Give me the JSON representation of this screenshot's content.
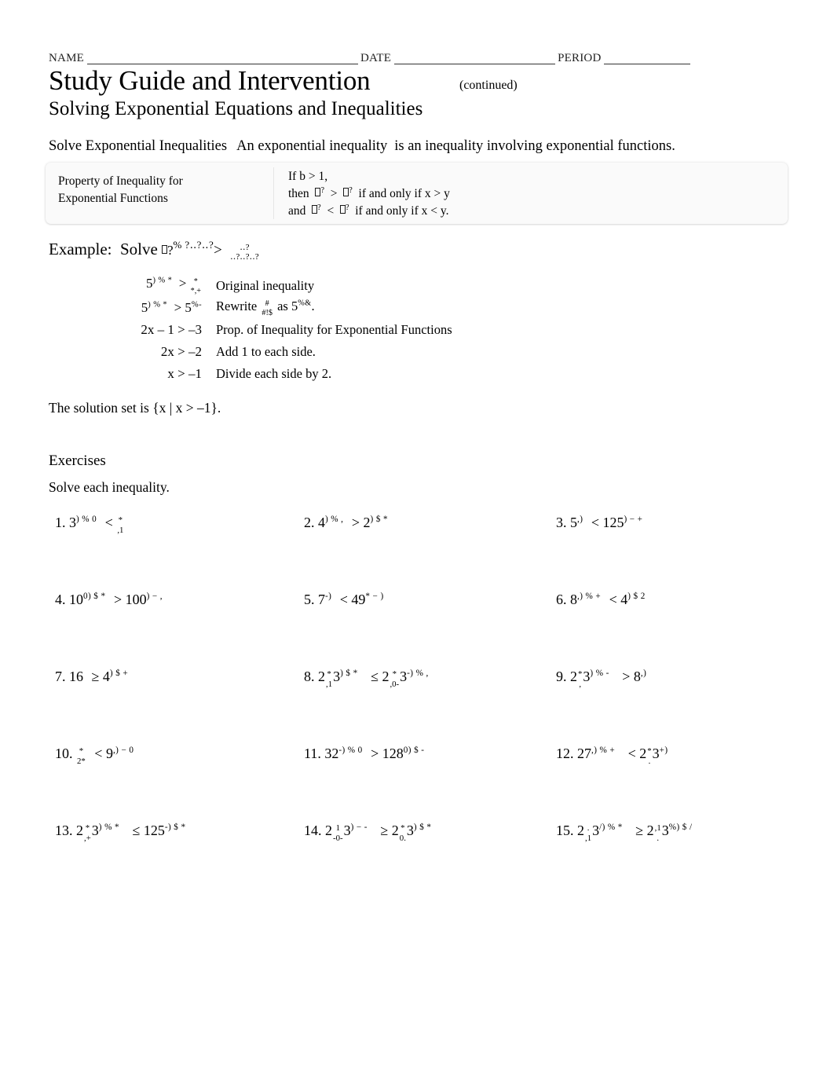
{
  "header": {
    "name_label": "NAME",
    "date_label": "DATE",
    "period_label": "PERIOD"
  },
  "title": {
    "main": "Study Guide and Intervention",
    "continued": "(continued)",
    "subtitle": "Solving Exponential Equations and Inequalities"
  },
  "lead": {
    "heading": "Solve Exponential Inequalities",
    "term": "An exponential inequality",
    "definition": "is an inequality involving exponential functions."
  },
  "property_box": {
    "label_line1": "Property of Inequality for",
    "label_line2": "Exponential Functions",
    "rule_line1": "If b > 1,",
    "rule_line2_prefix": "then",
    "rule_line2_relation": ">",
    "rule_line2_suffix": "if and only if  x > y",
    "rule_line3_prefix": "and",
    "rule_line3_relation": "<",
    "rule_line3_suffix": "if and only if  x < y."
  },
  "example": {
    "label": "Example:",
    "verb": "Solve",
    "base_glyphs": "‥?",
    "exp_glyphs": "% ?‥?‥?",
    "relation": ">",
    "frac_num": "‥?",
    "frac_den": "‥?‥?‥?"
  },
  "steps": [
    {
      "math_lead": "5",
      "math_sup": ") % *",
      "relation": ">",
      "frac_num": "*",
      "frac_den": "*,+",
      "math_tail": "",
      "desc": "Original inequality",
      "kind": "frac"
    },
    {
      "math_lead": "5",
      "math_sup": ") % *",
      "relation": ">",
      "math_tail": "5",
      "tail_sup": "%-",
      "desc_pre": "Rewrite",
      "desc_frac_num": "#",
      "desc_frac_den": "#!$",
      "desc_mid": "as",
      "desc_post": "5",
      "desc_post_sup": "%&",
      "desc_end": ".",
      "kind": "rewrite"
    },
    {
      "math": "2x – 1 > –3",
      "desc": "Prop. of Inequality for Exponential Functions",
      "kind": "plain"
    },
    {
      "math": "2x > –2",
      "desc": "Add 1 to each side.",
      "kind": "plain"
    },
    {
      "math": "x > –1",
      "desc": "Divide each side by 2.",
      "kind": "plain"
    }
  ],
  "solution_text": "The solution set is {x | x > –1}.",
  "exercises": {
    "title": "Exercises",
    "instruction": "Solve each inequality.",
    "items": [
      {
        "num": "1.",
        "layout": "base-frac",
        "base": "3",
        "base_sup": ") % 0",
        "relation": "<",
        "frac_num": "*",
        "frac_den": ",1"
      },
      {
        "num": "2.",
        "layout": "simple",
        "left": "4",
        "left_sup": ") % ,",
        "relation": ">",
        "right": "2",
        "right_sup": ") $ *"
      },
      {
        "num": "3.",
        "layout": "simple",
        "left": "5",
        "left_sup": ",)",
        "relation": "<",
        "right": "125",
        "right_sup": ") − +"
      },
      {
        "num": "4.",
        "layout": "simple",
        "left": "10",
        "left_sup": "0) $ *",
        "relation": ">",
        "right": "100",
        "right_sup": ") − ,"
      },
      {
        "num": "5.",
        "layout": "simple",
        "left": "7",
        "left_sup": "-)",
        "relation": "<",
        "right": "49",
        "right_sup": "* − )"
      },
      {
        "num": "6.",
        "layout": "simple",
        "left": "8",
        "left_sup": ") % +",
        "left_presup": ",",
        "relation": "<",
        "right": "4",
        "right_sup": ") $ 2"
      },
      {
        "num": "7.",
        "layout": "simple",
        "left": "16",
        "left_sup": "",
        "relation": "≥",
        "right": "4",
        "right_sup": ") $ +"
      },
      {
        "num": "8.",
        "layout": "twofrac",
        "l_a": "2",
        "l_a_num": "*",
        "l_a_den": ",1",
        "l_b": "3",
        "l_b_sup": ") $ *",
        "relation": "≤",
        "r_a": "2",
        "r_a_num": "*",
        "r_a_den": ",0-",
        "r_b": "3",
        "r_b_sup": "-) % ,"
      },
      {
        "num": "9.",
        "layout": "twofrac",
        "l_a": "2",
        "l_a_num": "*",
        "l_a_den": ",",
        "l_b": "3",
        "l_b_sup": ") % -",
        "relation": ">",
        "r_a": "8",
        "r_a_sup": ",)"
      },
      {
        "num": "10.",
        "layout": "lead-frac",
        "frac_num": "*",
        "frac_den": "2*",
        "relation": "<",
        "right": "9",
        "right_sup": ",) − 0"
      },
      {
        "num": "11.",
        "layout": "simple",
        "left": "32",
        "left_sup": "-) % 0",
        "relation": ">",
        "right": "128",
        "right_sup": "0) $ -"
      },
      {
        "num": "12.",
        "layout": "twofrac",
        "l_a": "27",
        "l_a_sup": ",) % +",
        "relation": "<",
        "r_a": "2",
        "r_a_num": "*",
        "r_a_den": ".",
        "r_b": "3",
        "r_b_sup": "+)"
      },
      {
        "num": "13.",
        "layout": "twofrac",
        "l_a": "2",
        "l_a_num": "*",
        "l_a_den": ",+",
        "l_b": "3",
        "l_b_sup": ") % *",
        "relation": "≤",
        "r_a": "125",
        "r_a_sup": "-) $ *"
      },
      {
        "num": "14.",
        "layout": "twofrac",
        "l_a": "2",
        "l_a_num": "1",
        "l_a_den": "-0-",
        "l_b": "3",
        "l_b_sup": ") − -",
        "relation": "≥",
        "r_a": "2",
        "r_a_num": "*",
        "r_a_den": "0.",
        "r_b": "3",
        "r_b_sup": ") $ *"
      },
      {
        "num": "15.",
        "layout": "twofrac",
        "l_a": "2",
        "l_a_num": ".",
        "l_a_den": ",1",
        "l_b": "3",
        "l_b_sup": "/) % *",
        "relation": "≥",
        "r_a": "2",
        "r_a_num": ",1",
        "r_a_den": ".",
        "r_b": "3",
        "r_b_sup": "%) $ /"
      }
    ]
  }
}
